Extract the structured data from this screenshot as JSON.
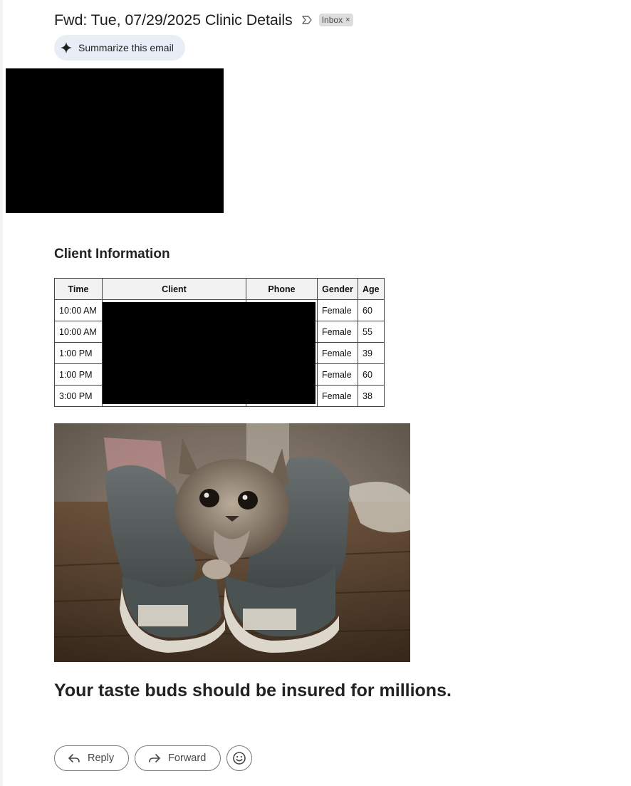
{
  "email": {
    "subject": "Fwd: Tue, 07/29/2025 Clinic Details",
    "label_chip": "Inbox",
    "label_remove_glyph": "×",
    "importance_icon": "importance-marker-icon"
  },
  "summarize": {
    "label": "Summarize this email",
    "icon": "sparkle-icon"
  },
  "section_title": "Client Information",
  "table": {
    "headers": [
      "Time",
      "Client",
      "Phone",
      "Gender",
      "Age"
    ],
    "rows": [
      {
        "time": "10:00 AM",
        "client": "",
        "phone": "",
        "gender": "Female",
        "age": "60"
      },
      {
        "time": "10:00 AM",
        "client": "",
        "phone": "",
        "gender": "Female",
        "age": "55"
      },
      {
        "time": "1:00 PM",
        "client": "",
        "phone": "",
        "gender": "Female",
        "age": "39"
      },
      {
        "time": "1:00 PM",
        "client": "",
        "phone": "",
        "gender": "Female",
        "age": "60"
      },
      {
        "time": "3:00 PM",
        "client": "",
        "phone": "",
        "gender": "Female",
        "age": "38"
      }
    ]
  },
  "tagline": "Your taste buds should be insured for millions.",
  "actions": {
    "reply": "Reply",
    "forward": "Forward",
    "reply_icon": "reply-arrow-icon",
    "forward_icon": "forward-arrow-icon",
    "emoji_icon": "smiley-icon"
  },
  "colors": {
    "summarize_bg": "#e9eef6",
    "chip_bg": "#dddddd",
    "table_header_bg": "#f2f2f2",
    "redaction": "#000000"
  }
}
